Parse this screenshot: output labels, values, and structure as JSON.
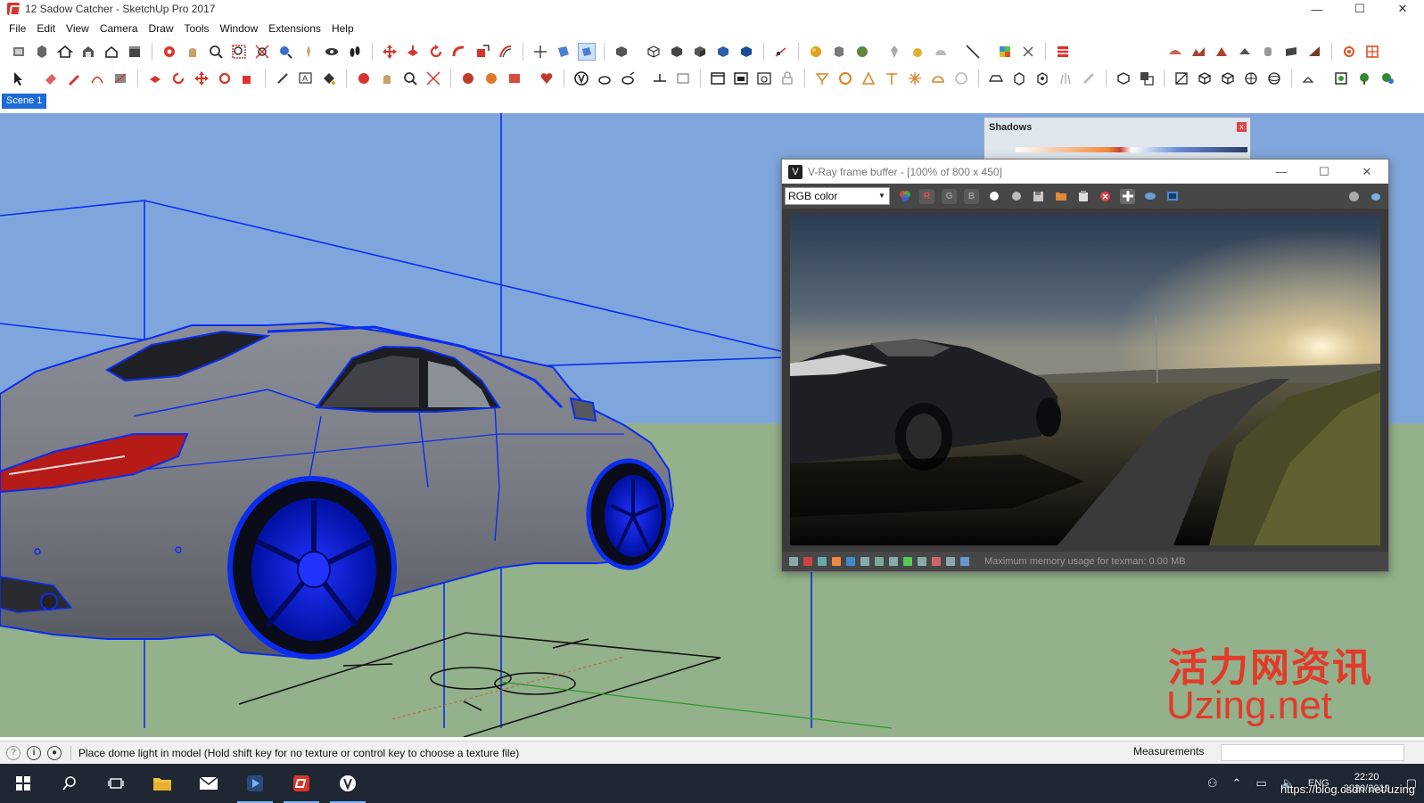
{
  "window": {
    "title": "12 Sadow Catcher - SketchUp Pro 2017",
    "minimize_glyph": "—",
    "maximize_glyph": "☐",
    "close_glyph": "✕"
  },
  "menu": [
    "File",
    "Edit",
    "View",
    "Camera",
    "Draw",
    "Tools",
    "Window",
    "Extensions",
    "Help"
  ],
  "scene_tab": "Scene 1",
  "shadows_dialog": {
    "title": "Shadows",
    "close_glyph": "x"
  },
  "vfb": {
    "title": "V-Ray frame buffer - [100% of 800 x 450]",
    "channel_selected": "RGB color",
    "channel_buttons": [
      "R",
      "G",
      "B"
    ],
    "status_text": "Maximum memory usage for texman: 0.00 MB"
  },
  "statusbar": {
    "message": "Place dome light in model (Hold shift key for no texture or control key to choose a texture file)",
    "measurements_label": "Measurements",
    "measurements_value": ""
  },
  "watermark": {
    "chinese": "活力网资讯",
    "english": "Uzing.net"
  },
  "taskbar": {
    "clock_time": "22:20",
    "clock_date": "2020/2019",
    "lang": "ENG",
    "url_overlay": "https://blog.csdn.net/uzing"
  },
  "colors": {
    "sky": "#7fa6dc",
    "ground": "#93b18a",
    "edge_selected": "#0a2cf0",
    "sketchup_red": "#d9342b",
    "taskbar": "#1f2733"
  }
}
